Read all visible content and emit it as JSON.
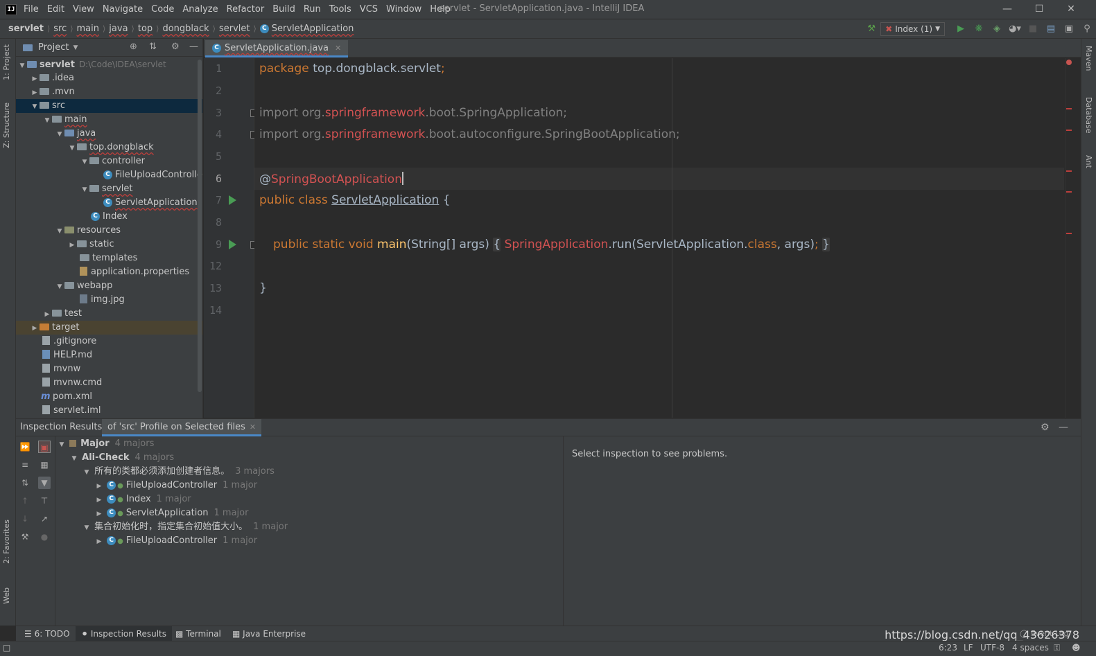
{
  "menu": {
    "items": [
      "File",
      "Edit",
      "View",
      "Navigate",
      "Code",
      "Analyze",
      "Refactor",
      "Build",
      "Run",
      "Tools",
      "VCS",
      "Window",
      "Help"
    ],
    "window_title": "servlet - ServletApplication.java - IntelliJ IDEA"
  },
  "breadcrumb": [
    "servlet",
    "src",
    "main",
    "java",
    "top",
    "dongblack",
    "servlet",
    "ServletApplication"
  ],
  "run_config": "Index (1)",
  "left_tabs": [
    "1: Project",
    "Z: Structure",
    "2: Favorites",
    "Web"
  ],
  "right_tabs": [
    "Maven",
    "Database",
    "Ant"
  ],
  "project": {
    "title": "Project",
    "root_name": "servlet",
    "root_path": "D:\\Code\\IDEA\\servlet",
    "tree": [
      ".idea",
      ".mvn",
      "src",
      "main",
      "java",
      "top.dongblack",
      "controller",
      "FileUploadControlle",
      "servlet",
      "ServletApplication",
      "Index",
      "resources",
      "static",
      "templates",
      "application.properties",
      "webapp",
      "img.jpg",
      "test",
      "target",
      ".gitignore",
      "HELP.md",
      "mvnw",
      "mvnw.cmd",
      "pom.xml",
      "servlet.iml"
    ]
  },
  "editor": {
    "tab_label": "ServletApplication.java",
    "line_numbers": [
      "1",
      "2",
      "3",
      "4",
      "5",
      "6",
      "7",
      "8",
      "9",
      "12",
      "13",
      "14"
    ],
    "code": {
      "l1_kw": "package ",
      "l1_pkg": "top.dongblack.servlet",
      "l1_semi": ";",
      "l3_kw": "import ",
      "l3_a": "org.",
      "l3_b": "springframework",
      "l3_c": ".boot.SpringApplication;",
      "l4_kw": "import ",
      "l4_a": "org.",
      "l4_b": "springframework",
      "l4_c": ".boot.autoconfigure.SpringBootApplication;",
      "l6_at": "@",
      "l6_ann": "SpringBootApplication",
      "l7_kw": "public class ",
      "l7_cls": "ServletApplication",
      "l7_brace": " {",
      "l9_kw": "public static void ",
      "l9_fn": "main",
      "l9_params": "(String[] args) ",
      "l9_open": "{",
      "l9_call": "SpringApplication",
      "l9_run": ".run(ServletApplication.",
      "l9_class": "class",
      "l9_args": ", args)",
      "l9_semi": ";",
      "l9_close": "}",
      "l13": "}"
    }
  },
  "inspection": {
    "title": "Inspection Results:",
    "tab_label": "of 'src' Profile on Selected files",
    "tree": [
      {
        "label": "Major",
        "count": "4 majors"
      },
      {
        "label": "Ali-Check",
        "count": "4 majors"
      },
      {
        "label": "所有的类都必须添加创建者信息。",
        "count": "3 majors"
      },
      {
        "label": "FileUploadController",
        "count": "1 major"
      },
      {
        "label": "Index",
        "count": "1 major"
      },
      {
        "label": "ServletApplication",
        "count": "1 major"
      },
      {
        "label": "集合初始化时，指定集合初始值大小。",
        "count": "1 major"
      },
      {
        "label": "FileUploadController",
        "count": "1 major"
      }
    ],
    "detail": "Select inspection to see problems."
  },
  "bottom_tabs": [
    "6: TODO",
    "Inspection Results",
    "Terminal",
    "Java Enterprise"
  ],
  "event_log": "Event Log",
  "watermark": "https://blog.csdn.net/qq_43626378",
  "status": {
    "position": "6:23",
    "line_sep": "LF",
    "encoding": "UTF-8",
    "indent": "4 spaces"
  },
  "colors": {
    "keyword": "#cc7832",
    "annotation_error": "#d25252",
    "function": "#ffc66d",
    "accent": "#4a88c7",
    "run_green": "#499c54"
  }
}
